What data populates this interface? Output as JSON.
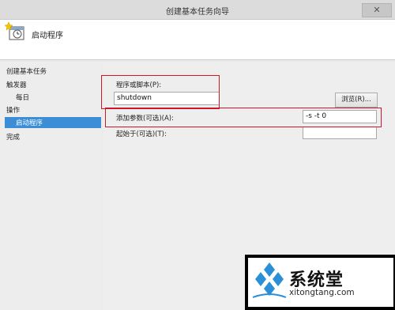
{
  "window": {
    "title": "创建基本任务向导",
    "close_glyph": "✕"
  },
  "header": {
    "heading": "启动程序"
  },
  "sidebar": {
    "items": [
      {
        "label": "创建基本任务"
      },
      {
        "label": "触发器"
      },
      {
        "label": "每日"
      },
      {
        "label": "操作"
      },
      {
        "label": "启动程序"
      },
      {
        "label": "完成"
      }
    ]
  },
  "form": {
    "program_label": "程序或脚本(P):",
    "program_value": "shutdown",
    "browse_label": "浏览(R)...",
    "args_label": "添加参数(可选)(A):",
    "args_value": "-s -t 0",
    "startin_label": "起始于(可选)(T):",
    "startin_value": ""
  },
  "watermark": {
    "brand": "系统堂",
    "url": "xitongtang.com"
  },
  "colors": {
    "accent": "#3b8ed6",
    "highlight_box": "#d0162a"
  }
}
